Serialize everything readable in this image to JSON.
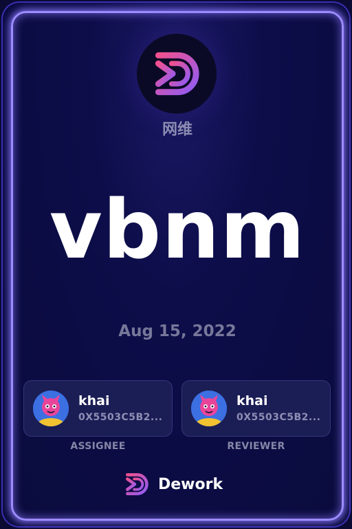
{
  "org": {
    "name": "网维",
    "logo_icon": "dework-logo-icon"
  },
  "task": {
    "title": "vbnm",
    "date": "Aug 15, 2022"
  },
  "assignee": {
    "name": "khai",
    "address": "0X5503C5B2...",
    "role": "ASSIGNEE",
    "avatar_icon": "avatar-icon"
  },
  "reviewer": {
    "name": "khai",
    "address": "0X5503C5B2...",
    "role": "REVIEWER",
    "avatar_icon": "avatar-icon"
  },
  "footer": {
    "brand": "Dework"
  },
  "colors": {
    "background": "#0b0a33",
    "frame": "#9d8cff",
    "accent_pink": "#e8459a",
    "accent_purple": "#8e5cf6"
  }
}
